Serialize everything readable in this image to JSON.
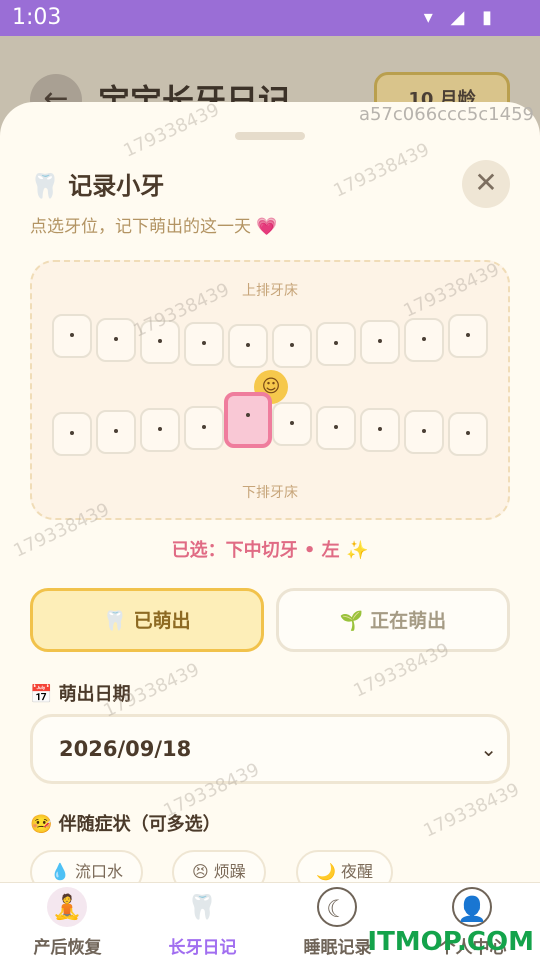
{
  "status": {
    "time": "1:03"
  },
  "header": {
    "title": "宝宝长牙日记",
    "age_badge": "10 月龄"
  },
  "watermarks": [
    "179338439",
    "a57c066ccc5c1459"
  ],
  "sheet": {
    "title": "🦷 记录小牙",
    "subtitle": "点选牙位，记下萌出的这一天 💗",
    "upper_label": "上排牙床",
    "lower_label": "下排牙床",
    "selected_text": "已选：下中切牙 • 左 ✨",
    "status_buttons": [
      {
        "label": "🦷 已萌出",
        "active": true
      },
      {
        "label": "🌱 正在萌出",
        "active": false
      }
    ],
    "date_label": "📅 萌出日期",
    "date_value": "2026/09/18",
    "symptoms_label": "🤒 伴随症状（可多选）",
    "symptoms": [
      "💧 流口水",
      "😣 烦躁",
      "🌙 夜醒"
    ]
  },
  "nav": [
    {
      "label": "产后恢复",
      "icon": "mother-icon",
      "active": false
    },
    {
      "label": "长牙日记",
      "icon": "tooth-icon",
      "active": true
    },
    {
      "label": "睡眠记录",
      "icon": "moon-icon",
      "active": false
    },
    {
      "label": "个人中心",
      "icon": "user-icon",
      "active": false
    }
  ],
  "footer_watermark": "ITMOP.COM",
  "colors": {
    "accent": "#a16ef0",
    "selected": "#e06b84",
    "active_btn": "#f1c24b"
  }
}
